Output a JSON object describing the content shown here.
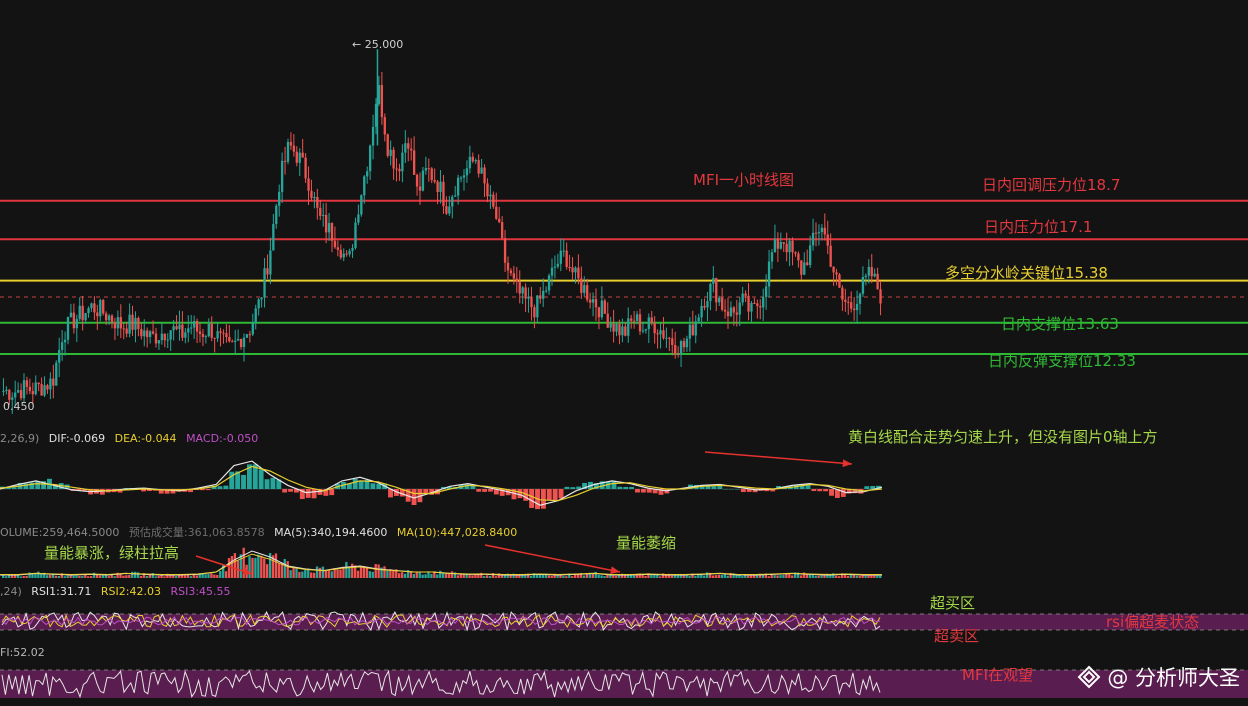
{
  "chart_data": {
    "type": "candlestick",
    "title": "MFI一小时线图",
    "price_range": [
      10.0,
      25.8
    ],
    "price_labels": {
      "high": "25.000",
      "low": "0.450"
    },
    "current_price": 14.7,
    "levels": [
      {
        "label": "日内回调压力位18.7",
        "value": 18.7,
        "color": "#e0353f"
      },
      {
        "label": "日内压力位17.1",
        "value": 17.1,
        "color": "#e0353f"
      },
      {
        "label": "多空分水岭关键位15.38",
        "value": 15.38,
        "color": "#e8cf2f"
      },
      {
        "label": "日内支撑位13.63",
        "value": 13.63,
        "color": "#2fb834"
      },
      {
        "label": "日内反弹支撑位12.33",
        "value": 12.33,
        "color": "#2fb834"
      }
    ],
    "close_path": [
      10.8,
      10.75,
      10.9,
      10.85,
      11.0,
      11.2,
      13.2,
      13.7,
      14.0,
      14.3,
      14.1,
      13.8,
      13.5,
      13.6,
      13.3,
      13.0,
      13.2,
      13.4,
      13.1,
      13.5,
      13.2,
      13.4,
      12.9,
      12.5,
      13.0,
      13.4,
      14.5,
      16.5,
      19.5,
      21.0,
      20.5,
      19.5,
      18.0,
      17.5,
      17.0,
      16.0,
      18.5,
      20.5,
      23.5,
      21.0,
      20.0,
      21.5,
      19.0,
      20.0,
      19.5,
      18.5,
      19.5,
      20.0,
      20.5,
      19.0,
      18.0,
      16.0,
      15.0,
      14.5,
      14.2,
      15.0,
      16.0,
      16.5,
      15.5,
      15.0,
      14.5,
      14.0,
      13.5,
      13.2,
      13.8,
      13.4,
      13.6,
      13.2,
      12.8,
      12.6,
      13.5,
      14.6,
      15.2,
      14.3,
      14.0,
      14.5,
      14.0,
      14.8,
      16.5,
      17.2,
      16.5,
      15.8,
      16.8,
      17.8,
      16.2,
      14.6,
      14.3,
      15.0,
      15.7,
      14.8
    ],
    "macd": {
      "legend_prefix": "2,26,9)",
      "DIF": "DIF:-0.069",
      "DEA": "DEA:-0.044",
      "MACD": "MACD:-0.050",
      "hist": [
        0.2,
        0.6,
        0.9,
        0.5,
        -0.2,
        -0.5,
        -0.3,
        0.1,
        -0.2,
        -0.4,
        -0.3,
        -0.1,
        0.3,
        1.6,
        2.2,
        1.0,
        -0.3,
        -0.9,
        -0.6,
        0.6,
        1.0,
        0.5,
        -0.8,
        -1.4,
        -0.6,
        0.2,
        0.5,
        -0.3,
        -0.6,
        -1.0,
        -1.8,
        -1.0,
        0.2,
        0.6,
        0.7,
        0.2,
        -0.4,
        -0.5,
        0.0,
        0.4,
        0.3,
        0.0,
        -0.3,
        -0.2,
        0.3,
        0.4,
        -0.2,
        -0.8,
        -0.4,
        0.3
      ],
      "dif": [
        0.0,
        0.5,
        0.9,
        0.4,
        -0.1,
        -0.3,
        -0.2,
        0.0,
        0.1,
        -0.1,
        -0.2,
        0.1,
        0.5,
        2.6,
        3.1,
        1.6,
        0.4,
        -0.4,
        -0.2,
        0.9,
        1.3,
        0.7,
        -0.3,
        -1.0,
        -0.4,
        0.3,
        0.6,
        0.2,
        -0.2,
        -0.7,
        -1.8,
        -1.3,
        -0.2,
        0.5,
        0.9,
        0.6,
        0.1,
        -0.2,
        0.1,
        0.4,
        0.5,
        0.2,
        -0.1,
        0.0,
        0.4,
        0.6,
        0.3,
        -0.4,
        -0.3,
        0.2
      ],
      "dea": [
        0.1,
        0.3,
        0.6,
        0.5,
        0.2,
        -0.1,
        -0.2,
        -0.1,
        0.0,
        -0.1,
        -0.1,
        0.0,
        0.3,
        1.6,
        2.5,
        2.0,
        1.0,
        0.2,
        -0.2,
        0.4,
        0.9,
        0.8,
        0.2,
        -0.5,
        -0.5,
        0.0,
        0.4,
        0.3,
        0.0,
        -0.4,
        -1.2,
        -1.3,
        -0.7,
        0.1,
        0.6,
        0.7,
        0.3,
        0.0,
        0.0,
        0.3,
        0.4,
        0.3,
        0.1,
        0.0,
        0.2,
        0.5,
        0.4,
        0.0,
        -0.2,
        0.0
      ],
      "annotation": "黄白线配合走势匀速上升，但没有图片0轴上方"
    },
    "volume": {
      "VOLUME": "OLUME:259,464.5000",
      "predicted": "预估成交量:361,063.8578",
      "MA5": "MA(5):340,194.4600",
      "MA10": "MA(10):447,028.8400",
      "annotation_left": "量能暴涨，绿柱拉高",
      "annotation_right": "量能萎缩",
      "ma_path": [
        0.1,
        0.1,
        0.15,
        0.12,
        0.1,
        0.12,
        0.1,
        0.15,
        0.12,
        0.1,
        0.1,
        0.12,
        0.2,
        0.6,
        0.9,
        0.7,
        0.4,
        0.3,
        0.25,
        0.35,
        0.4,
        0.3,
        0.25,
        0.2,
        0.2,
        0.15,
        0.12,
        0.12,
        0.1,
        0.1,
        0.12,
        0.1,
        0.12,
        0.15,
        0.1,
        0.1,
        0.12,
        0.1,
        0.1,
        0.12,
        0.15,
        0.1,
        0.1,
        0.12,
        0.15,
        0.12,
        0.1,
        0.12,
        0.1,
        0.1
      ]
    },
    "rsi": {
      "prefix": ",24)",
      "RSI1": "RSI1:31.71",
      "RSI2": "RSI2:42.03",
      "RSI3": "RSI3:45.55",
      "overbought_label": "超买区",
      "oversold_label": "超卖区",
      "annotation": "rsi偏超麦状态",
      "band_color": "#5a1d4f"
    },
    "mfi": {
      "legend": "FI:52.02",
      "annotation": "MFI在观望"
    },
    "colors": {
      "up": "#26a69a",
      "down": "#ef5350",
      "white_line": "#e6e6e6",
      "yellow_line": "#e8cf2f",
      "purple_line": "#c04fc8",
      "annot_green": "#a6d94a",
      "annot_red": "#e2383f",
      "arrow": "#e5322d"
    }
  },
  "watermark": {
    "text": "@ 分析师大圣",
    "icon": "binance-diamond-icon"
  }
}
